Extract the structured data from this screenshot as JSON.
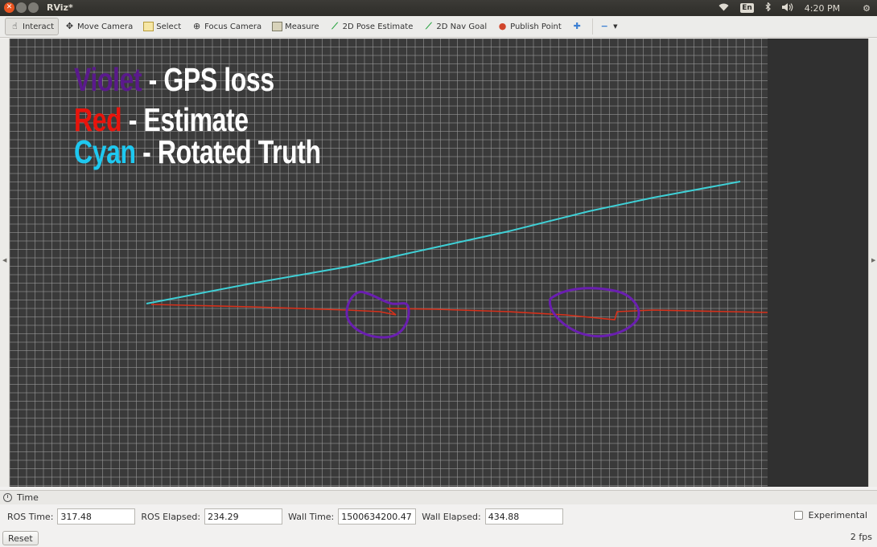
{
  "window": {
    "title": "RViz*"
  },
  "system_tray": {
    "language": "En",
    "clock": "4:20 PM",
    "icons": [
      "wifi-icon",
      "bluetooth-icon",
      "volume-icon",
      "settings-gear-icon"
    ]
  },
  "toolbar": {
    "tools": [
      {
        "label": "Interact",
        "icon": "hand-icon",
        "active": true
      },
      {
        "label": "Move Camera",
        "icon": "move-camera-icon"
      },
      {
        "label": "Select",
        "icon": "select-box-icon"
      },
      {
        "label": "Focus Camera",
        "icon": "focus-camera-icon"
      },
      {
        "label": "Measure",
        "icon": "ruler-icon"
      },
      {
        "label": "2D Pose Estimate",
        "icon": "green-arrow-icon"
      },
      {
        "label": "2D Nav Goal",
        "icon": "green-arrow-icon"
      },
      {
        "label": "Publish Point",
        "icon": "red-pin-icon"
      }
    ],
    "add_tool": "plus-icon",
    "remove_tool": "minus-icon"
  },
  "viewport": {
    "background_color": "#303030",
    "grid_color": "#a0a0a0",
    "legend": [
      {
        "color_word": "Violet",
        "description": "- GPS loss",
        "color": "#5a1a8c"
      },
      {
        "color_word": "Red",
        "description": "- Estimate",
        "color": "#e8140c"
      },
      {
        "color_word": "Cyan",
        "description": "- Rotated Truth",
        "color": "#1ec8f0"
      }
    ],
    "trajectories": {
      "truth_color": "#3fd0d6",
      "estimate_color": "#d8301a",
      "gps_loss_color": "#6a1fb0"
    }
  },
  "time_panel": {
    "title": "Time",
    "ros_time_label": "ROS Time:",
    "ros_time_value": "317.48",
    "ros_elapsed_label": "ROS Elapsed:",
    "ros_elapsed_value": "234.29",
    "wall_time_label": "Wall Time:",
    "wall_time_value": "1500634200.47",
    "wall_elapsed_label": "Wall Elapsed:",
    "wall_elapsed_value": "434.88",
    "experimental_label": "Experimental",
    "experimental_checked": false
  },
  "status_bar": {
    "reset_label": "Reset",
    "fps": "2 fps"
  }
}
